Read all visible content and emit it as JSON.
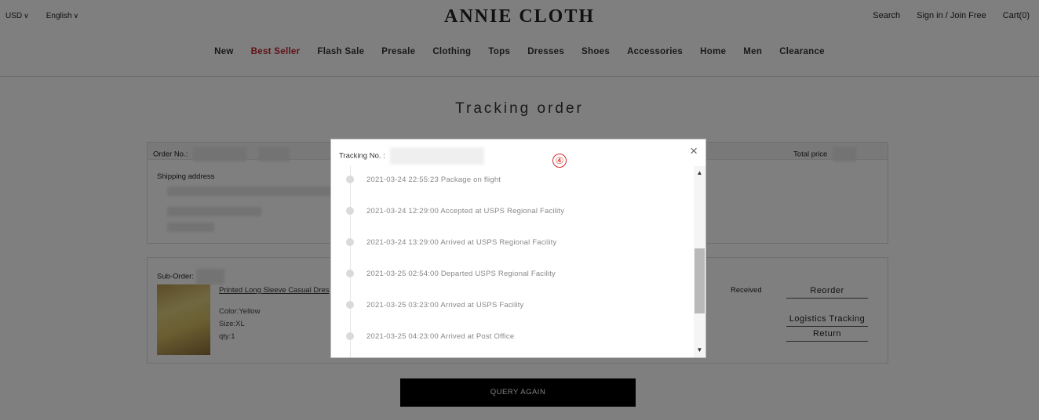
{
  "header": {
    "currency": "USD",
    "language": "English",
    "logo": "ANNIE CLOTH",
    "search": "Search",
    "sign_in": "Sign in / Join Free",
    "cart": "Cart(0)"
  },
  "nav": [
    "New",
    "Best Seller",
    "Flash Sale",
    "Presale",
    "Clothing",
    "Tops",
    "Dresses",
    "Shoes",
    "Accessories",
    "Home",
    "Men",
    "Clearance"
  ],
  "page": {
    "title": "Tracking order",
    "order_no_label": "Order No.:",
    "total_price_label": "Total price",
    "shipping_address_label": "Shipping address",
    "sub_order_label": "Sub-Order:",
    "query_again": "QUERY AGAIN"
  },
  "product": {
    "name": "Printed Long Sleeve Casual Dres",
    "color": "Color:Yellow",
    "size": "Size:XL",
    "qty": "qty:1",
    "status": "Received",
    "actions": [
      "Reorder",
      "Logistics Tracking",
      "Return"
    ]
  },
  "modal": {
    "tracking_label": "Tracking No. :",
    "badge": "④",
    "close": "×",
    "events": [
      "2021-03-24 22:55:23 Package on flight",
      "2021-03-24 12:29:00 Accepted at USPS Regional Facility",
      "2021-03-24 13:29:00 Arrived at USPS Regional Facility",
      "2021-03-25 02:54:00 Departed USPS Regional Facility",
      "2021-03-25 03:23:00 Arrived at USPS Facility",
      "2021-03-25 04:23:00 Arrived at Post Office"
    ]
  },
  "icons": {
    "chevron_down": "chevron-down-icon",
    "close": "close-icon",
    "scroll_up": "arrow-up-icon",
    "scroll_down": "arrow-down-icon"
  }
}
